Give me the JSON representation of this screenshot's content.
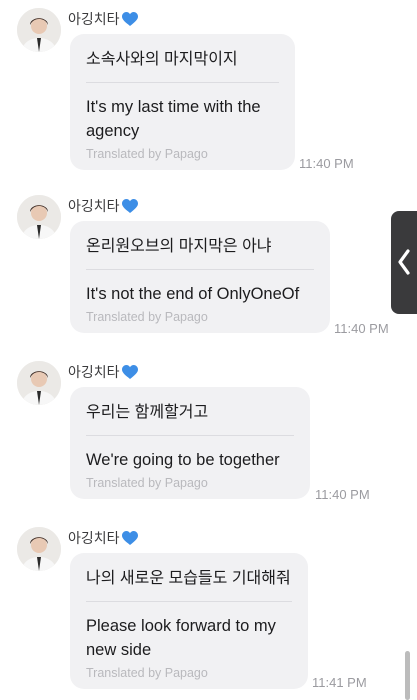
{
  "messages": [
    {
      "sender": "아깅치타",
      "original": "소속사와의 마지막이지",
      "translated": [
        "It's my last time with the",
        "agency"
      ],
      "credit": "Translated by Papago",
      "time": "11:40 PM"
    },
    {
      "sender": "아깅치타",
      "original": "온리원오브의 마지막은 아냐",
      "translated": [
        "It's not the end of OnlyOneOf"
      ],
      "credit": "Translated by Papago",
      "time": "11:40 PM"
    },
    {
      "sender": "아깅치타",
      "original": "우리는 함께할거고",
      "translated": [
        "We're going to be together"
      ],
      "credit": "Translated by Papago",
      "time": "11:40 PM"
    },
    {
      "sender": "아깅치타",
      "original": "나의 새로운 모습들도 기대해줘",
      "translated": [
        "Please look forward to my",
        "new side"
      ],
      "credit": "Translated by Papago",
      "time": "11:41 PM"
    }
  ],
  "colors": {
    "bubble": "#f1f1f3",
    "heart": "#3d8ee6",
    "timestamp": "#9b9ba0",
    "credit": "#b9b9bd"
  },
  "icons": {
    "heart": "blue-heart-icon",
    "side_tab": "chevron-left-icon"
  }
}
